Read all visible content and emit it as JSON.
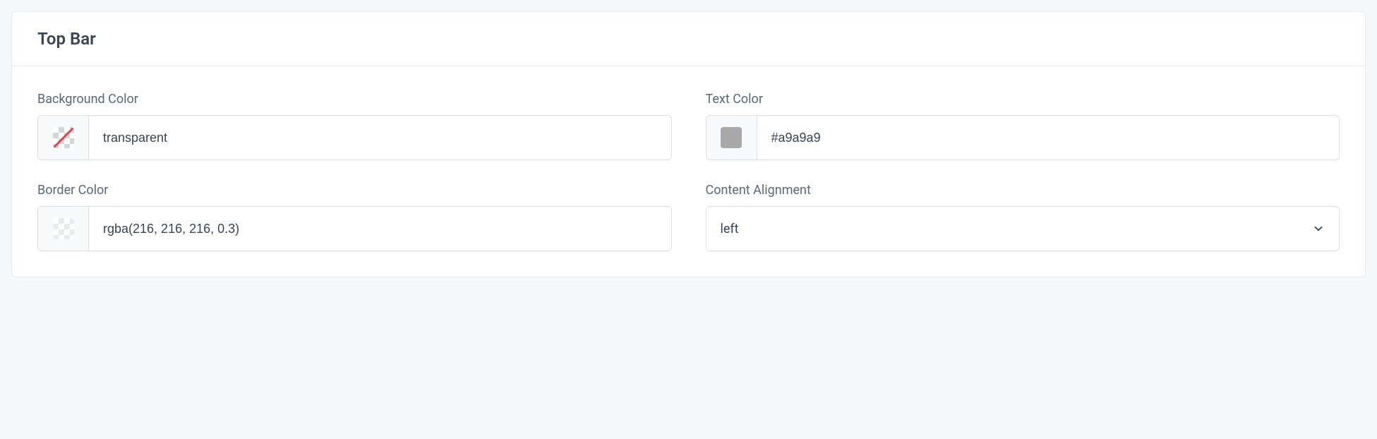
{
  "panel": {
    "title": "Top Bar",
    "fields": {
      "background_color": {
        "label": "Background Color",
        "value": "transparent",
        "swatch_type": "transparent"
      },
      "text_color": {
        "label": "Text Color",
        "value": "#a9a9a9",
        "swatch_color": "#a9a9a9"
      },
      "border_color": {
        "label": "Border Color",
        "value": "rgba(216, 216, 216, 0.3)",
        "swatch_type": "semi-transparent"
      },
      "content_alignment": {
        "label": "Content Alignment",
        "value": "left"
      }
    }
  }
}
